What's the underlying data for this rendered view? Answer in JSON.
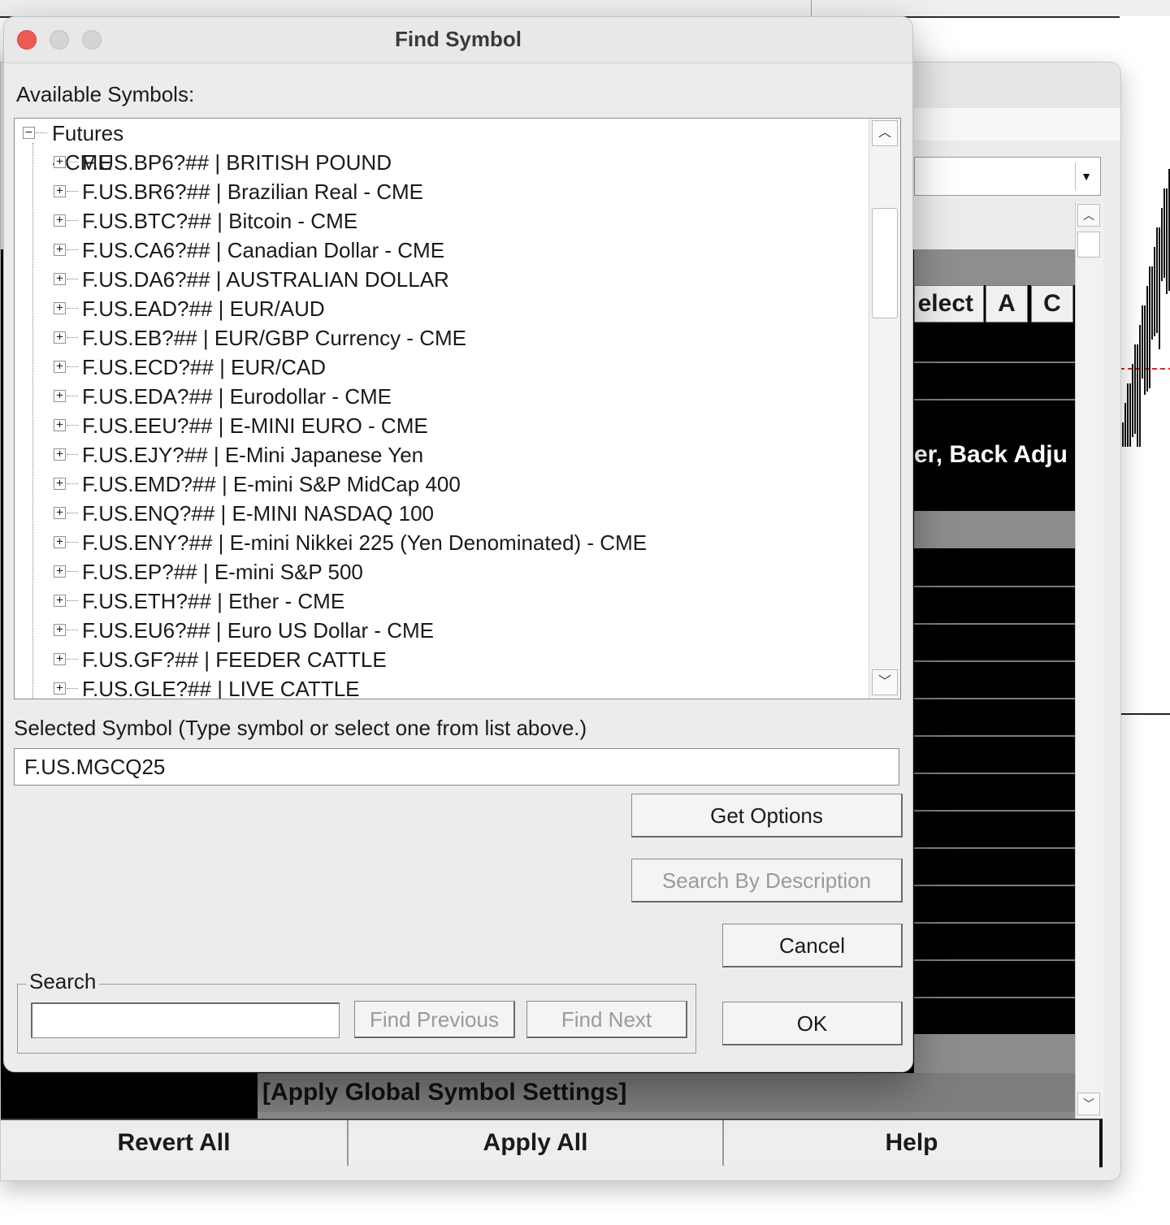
{
  "background_window": {
    "columns": [
      "elect",
      "A",
      "C"
    ],
    "row_text": "er, Back Adju",
    "global_row": "[Apply Global Symbol Settings]",
    "buttons": {
      "revert_all": "Revert All",
      "apply_all": "Apply All",
      "help": "Help"
    }
  },
  "dialog": {
    "title": "Find Symbol",
    "available_label": "Available Symbols:",
    "tree": {
      "root": "Futures - CME",
      "items": [
        "F.US.BP6?## | BRITISH POUND",
        "F.US.BR6?## | Brazilian Real - CME",
        "F.US.BTC?## | Bitcoin - CME",
        "F.US.CA6?## | Canadian Dollar - CME",
        "F.US.DA6?## | AUSTRALIAN DOLLAR",
        "F.US.EAD?## | EUR/AUD",
        "F.US.EB?## | EUR/GBP Currency - CME",
        "F.US.ECD?## | EUR/CAD",
        "F.US.EDA?## | Eurodollar - CME",
        "F.US.EEU?## | E-MINI EURO - CME",
        "F.US.EJY?## | E-Mini Japanese Yen",
        "F.US.EMD?## | E-mini S&P MidCap 400",
        "F.US.ENQ?## | E-MINI NASDAQ 100",
        "F.US.ENY?## | E-mini Nikkei 225 (Yen Denominated) - CME",
        "F.US.EP?## | E-mini S&P 500",
        "F.US.ETH?## | Ether - CME",
        "F.US.EU6?## | Euro US Dollar - CME",
        "F.US.GF?## | FEEDER CATTLE",
        "F.US.GLE?## | LIVE CATTLE"
      ]
    },
    "selected_label": "Selected Symbol (Type symbol or select one from list above.)",
    "selected_value": "F.US.MGCQ25",
    "buttons": {
      "get_options": "Get Options",
      "search_by_description": "Search By Description",
      "cancel": "Cancel",
      "ok": "OK"
    },
    "search": {
      "legend": "Search",
      "value": "",
      "find_previous": "Find Previous",
      "find_next": "Find Next"
    },
    "icons": {
      "expand": "plus-box-icon",
      "collapse": "minus-box-icon",
      "scroll_up": "chevron-up-icon",
      "scroll_down": "chevron-down-icon"
    },
    "colors": {
      "close_light": "#ee5b55",
      "dialog_bg": "#ececec",
      "disabled_text": "#9a9a9a"
    }
  }
}
